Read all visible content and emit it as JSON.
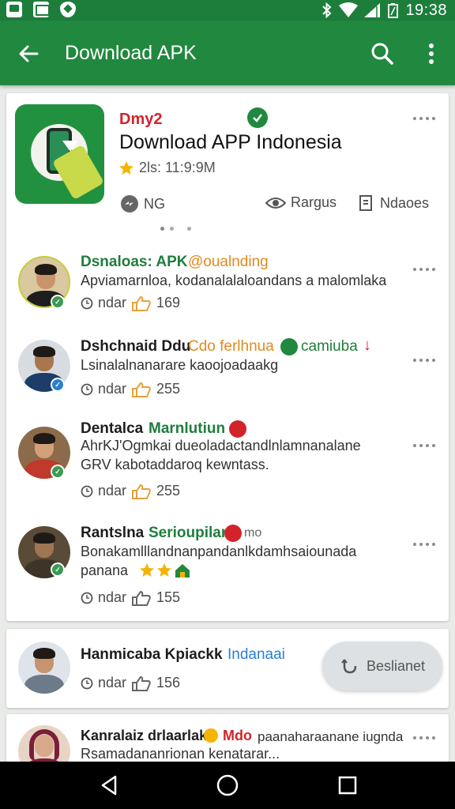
{
  "status_bar": {
    "time": "19:38",
    "left_icons": [
      "gallery-icon",
      "image-icon",
      "shield-icon"
    ],
    "right_icons": [
      "bluetooth-icon",
      "wifi-icon",
      "signal-icon",
      "battery-icon"
    ]
  },
  "app_bar": {
    "title": "Download APK",
    "back_icon": "arrow-left-icon",
    "search_icon": "search-icon",
    "menu_icon": "more-vertical-icon"
  },
  "app_card": {
    "developer": "Dmy2",
    "title": "Download APP Indonesia",
    "rating_text": "2ls: 11:9:9M",
    "stat_left": "NG",
    "stat_mid": "Rargus",
    "stat_right": "Ndaoes",
    "colors": {
      "developer": "#d2232a",
      "verified": "#21883f",
      "star": "#f4b400"
    }
  },
  "comments": [
    {
      "name": "Dsnaloas: APK",
      "tag": "@oualnding",
      "line1": "Apviamarnloa, kodanalalaloandans a malomlaka",
      "line2": "",
      "stats_label": "ndar",
      "likes": "169",
      "name_color": "#1f7d3c",
      "tag_color": "#e08a1e"
    },
    {
      "name": "Dshchnaid Ddu",
      "tag": "Cdo ferlhnua",
      "tag2": "camiuba",
      "line1": "Lsinalalnanarare kaoojoadaakg",
      "line2": "",
      "stats_label": "ndar",
      "likes": "255",
      "name_color": "#1d1d1d",
      "tag_color": "#e08a1e",
      "tag2_color": "#1f7d3c"
    },
    {
      "name": "Dentalca",
      "tag": "Marnlutiun",
      "line1": "AhrKJ'Ogmkai dueoladactandlnlamnanalane",
      "line2": "GRV kabotaddaroq kewntass.",
      "stats_label": "ndar",
      "likes": "255",
      "name_color": "#1d1d1d",
      "tag_color": "#1f7d3c"
    },
    {
      "name": "Rantslna",
      "tag": "Serioupilan",
      "tag_suffix": "mo",
      "line1": "Bonakamlllandnanpandanlkdamhsaiounada",
      "line2": "panana",
      "stats_label": "ndar",
      "likes": "155",
      "name_color": "#1d1d1d",
      "tag_color": "#1f7d3c"
    }
  ],
  "bottom_card": {
    "name": "Hanmicaba Kpiackk",
    "tag": "Indanaai",
    "stats_label": "ndar",
    "likes": "156",
    "button_label": "Beslianet"
  },
  "last_item": {
    "name": "Kanralaiz drlaarlak",
    "tag": "Mdo",
    "line1": "Rsamadananrionan kenatarar...",
    "extra": "paanaharaanane iugnda"
  }
}
